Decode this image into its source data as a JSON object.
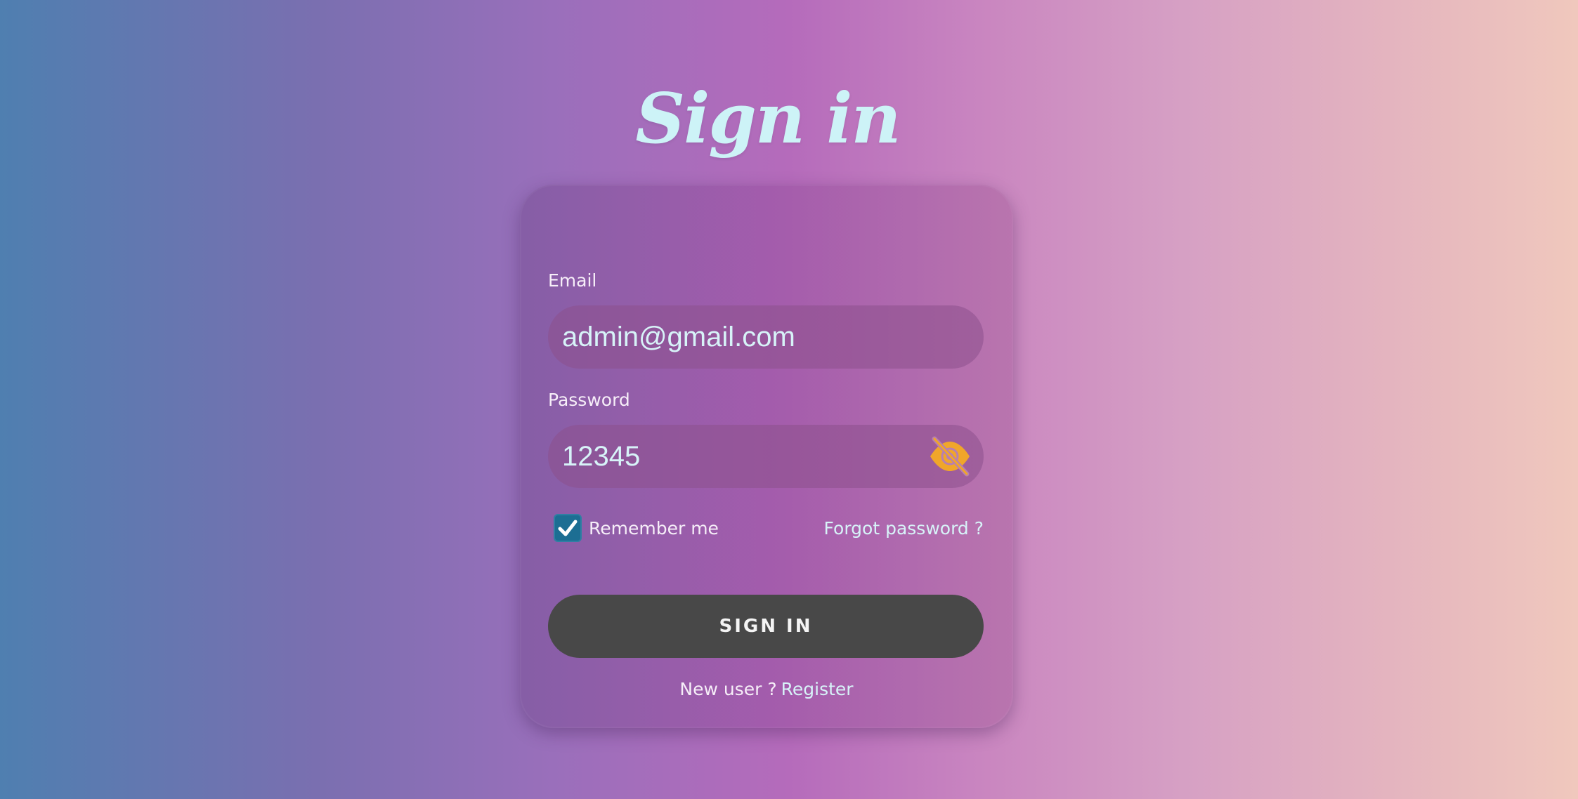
{
  "page": {
    "title": "Sign in"
  },
  "form": {
    "email_label": "Email",
    "email_value": "admin@gmail.com",
    "password_label": "Password",
    "password_value": "12345",
    "password_toggle_icon": "eye-slash-icon",
    "remember_label": "Remember me",
    "remember_checked": true,
    "forgot_link": "Forgot password ?",
    "submit_label": "SIGN IN",
    "new_user_text": "New user ?",
    "register_link": "Register"
  },
  "colors": {
    "title": "#cdf3f7",
    "input_text": "#d7f3f8",
    "checkbox": "#1c6e93",
    "button_bg": "#484848",
    "eye_icon": "#f0a62a"
  }
}
